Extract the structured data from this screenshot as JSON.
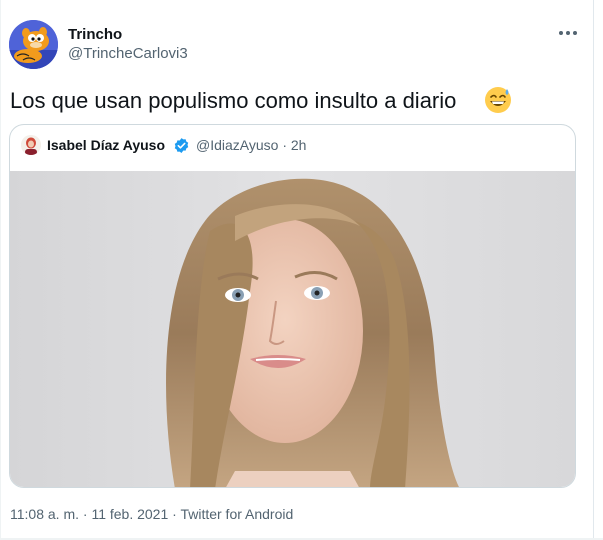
{
  "tweet": {
    "author_name": "Trincho",
    "author_handle": "@TrincheCarlovi3",
    "avatar_icon": "garfield-avatar",
    "more_icon": "more-options-icon",
    "text": "Los que usan populismo como insulto a diario",
    "emoji_icon": "grinning-sweat-emoji",
    "timestamp": "11:08 a. m. · 11 feb. 2021 · Twitter for Android"
  },
  "quoted_tweet": {
    "author_name": "Isabel Díaz Ayuso",
    "verified_icon": "verified-badge-icon",
    "meta": "@IdiazAyuso · 2h",
    "avatar_icon": "profile-avatar",
    "image_icon": "portrait-photo"
  },
  "colors": {
    "text_primary": "#0f1419",
    "text_secondary": "#536471",
    "border": "#cfd9de",
    "verified_blue": "#1d9bf0"
  }
}
